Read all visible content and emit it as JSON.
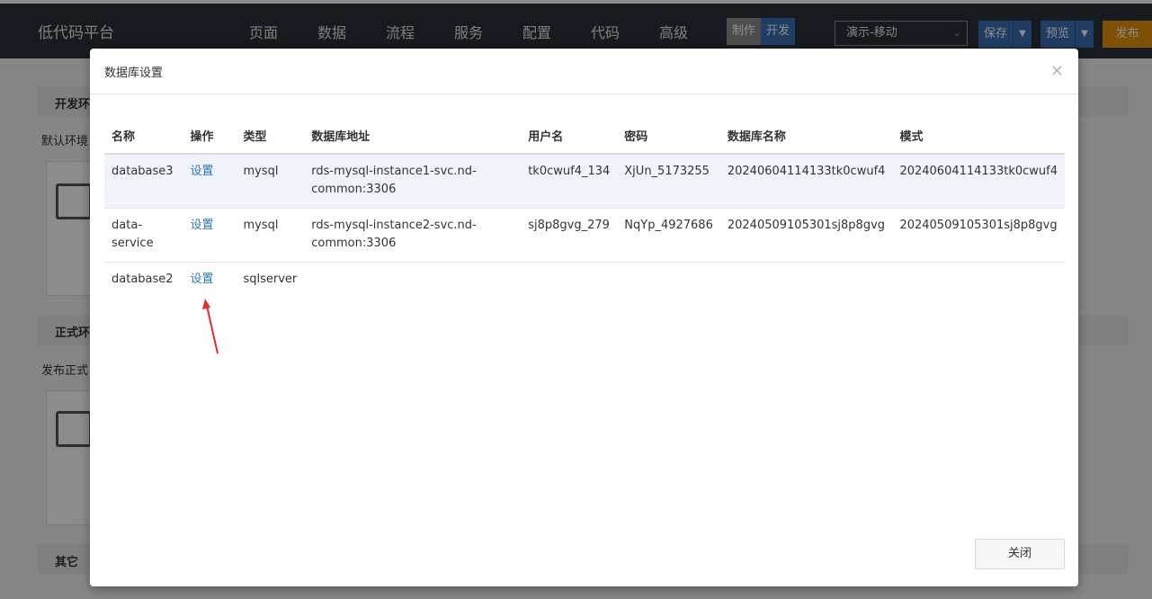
{
  "app": {
    "brand": "低代码平台",
    "nav": [
      "页面",
      "数据",
      "流程",
      "服务",
      "配置",
      "代码",
      "高级"
    ],
    "mode_make": "制作",
    "mode_dev": "开发",
    "env_select": "演示-移动",
    "save_label": "保存",
    "preview_label": "预览",
    "publish_label": "发布"
  },
  "background": {
    "dev_section": "开发环",
    "dev_text": "默认环境",
    "prod_section": "正式环",
    "prod_text": "发布正式",
    "other_section": "其它"
  },
  "modal": {
    "title": "数据库设置",
    "close_label": "关闭",
    "columns": [
      "名称",
      "操作",
      "类型",
      "数据库地址",
      "用户名",
      "密码",
      "数据库名称",
      "模式"
    ],
    "rows": [
      {
        "name": "database3",
        "action": "设置",
        "type": "mysql",
        "address": "rds-mysql-instance1-svc.nd-common:3306",
        "username": "tk0cwuf4_134",
        "password": "XjUn_5173255",
        "db_name": "20240604114133tk0cwuf4",
        "schema": "20240604114133tk0cwuf4"
      },
      {
        "name": "data-service",
        "action": "设置",
        "type": "mysql",
        "address": "rds-mysql-instance2-svc.nd-common:3306",
        "username": "sj8p8gvg_279",
        "password": "NqYp_4927686",
        "db_name": "20240509105301sj8p8gvg",
        "schema": "20240509105301sj8p8gvg"
      },
      {
        "name": "database2",
        "action": "设置",
        "type": "sqlserver",
        "address": "",
        "username": "",
        "password": "",
        "db_name": "",
        "schema": ""
      }
    ]
  },
  "colors": {
    "topbar": "#2b3038",
    "accent_blue": "#3b6fb6",
    "publish_orange": "#e8940f",
    "link": "#2a7ab8",
    "annotation_arrow": "#e0302a"
  }
}
